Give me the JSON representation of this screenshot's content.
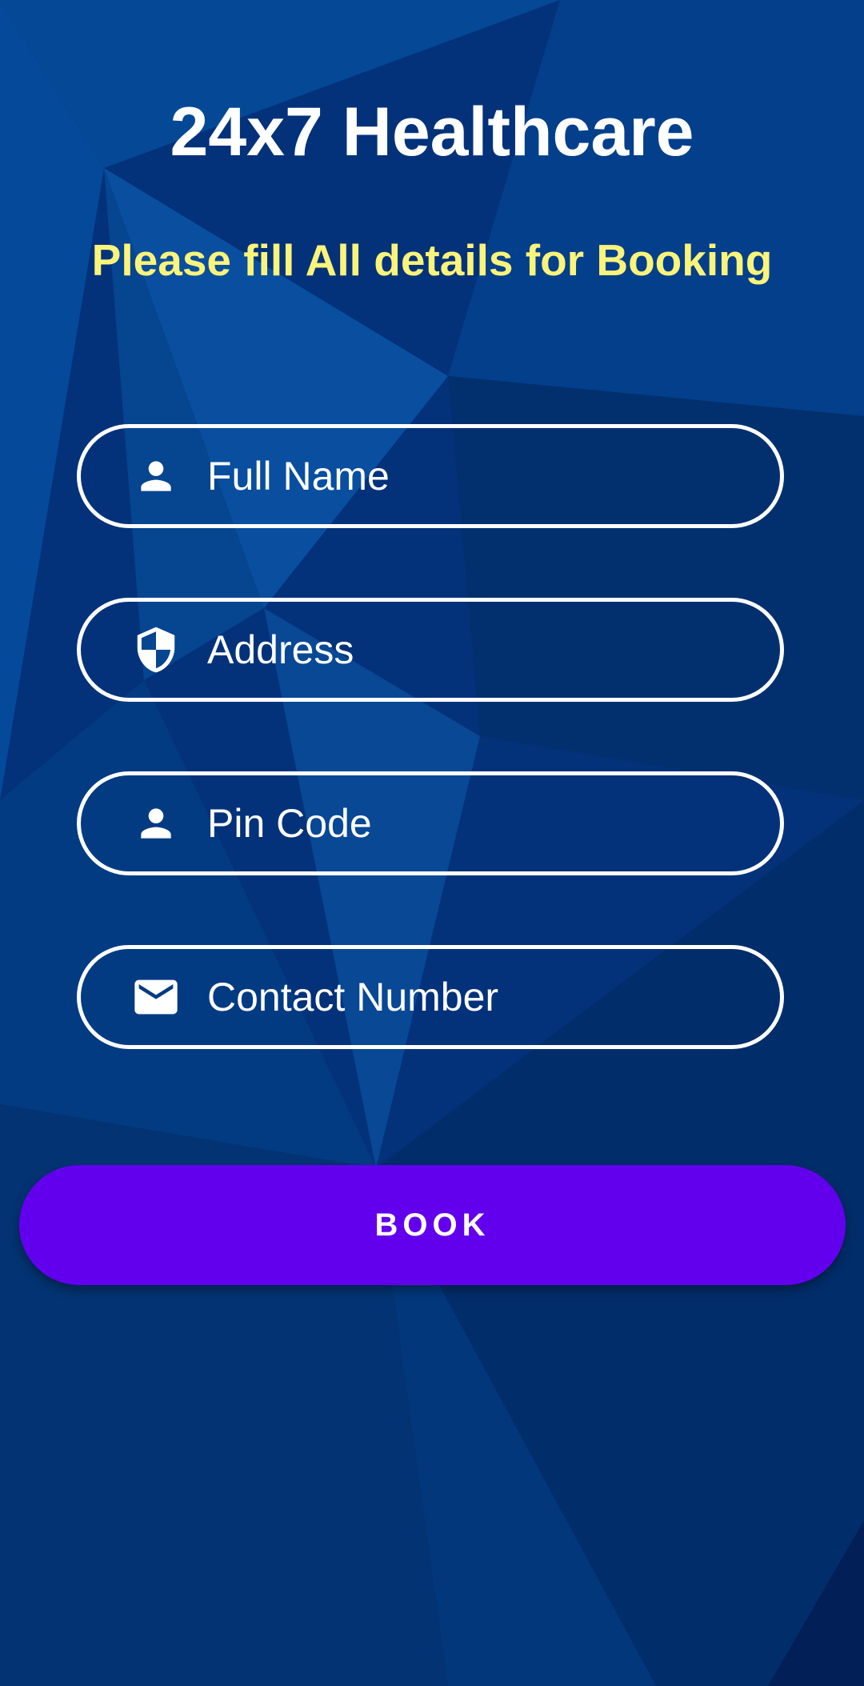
{
  "header": {
    "title": "24x7 Healthcare",
    "subtitle": "Please fill All details for Booking"
  },
  "form": {
    "fields": [
      {
        "placeholder": "Full Name",
        "value": "",
        "icon": "person-icon"
      },
      {
        "placeholder": "Address",
        "value": "",
        "icon": "shield-icon"
      },
      {
        "placeholder": "Pin Code",
        "value": "",
        "icon": "person-icon"
      },
      {
        "placeholder": "Contact Number",
        "value": "",
        "icon": "mail-icon"
      }
    ],
    "submit_label": "BOOK"
  },
  "colors": {
    "background": "#03327a",
    "subtitle": "#fbf47a",
    "button": "#6200ee",
    "text": "#ffffff"
  }
}
